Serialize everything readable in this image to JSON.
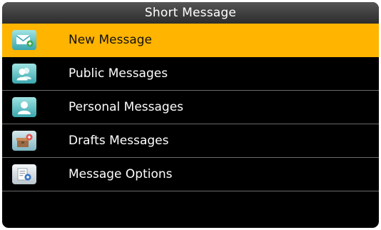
{
  "title": "Short Message",
  "menu": {
    "items": [
      {
        "label": "New Message",
        "icon": "envelope-plus-icon",
        "selected": true
      },
      {
        "label": "Public Messages",
        "icon": "users-icon",
        "selected": false
      },
      {
        "label": "Personal Messages",
        "icon": "user-icon",
        "selected": false
      },
      {
        "label": "Drafts Messages",
        "icon": "drafts-box-icon",
        "selected": false
      },
      {
        "label": "Message Options",
        "icon": "document-gear-icon",
        "selected": false
      }
    ]
  },
  "colors": {
    "selected_background": "#ffb400",
    "screen_background": "#000000",
    "icon_teal": "#3aa6ad"
  }
}
